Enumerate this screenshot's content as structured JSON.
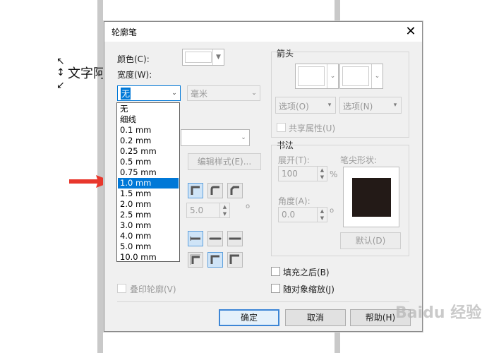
{
  "document": {
    "selected_text": "文字阿"
  },
  "dialog": {
    "title": "轮廓笔",
    "close_glyph": "✕",
    "color_label": "颜色(C):",
    "width_label": "宽度(W):",
    "width_value": "无",
    "unit_value": "毫米",
    "edit_style_label": "编辑样式(E)...",
    "miter_value": "5.0",
    "degree_glyph": "o",
    "overprint_label": "叠印轮廓(V)",
    "arrows": {
      "title": "箭头",
      "options_left": "选项(O)",
      "options_right": "选项(N)",
      "share_label": "共享属性(U)"
    },
    "calligraphy": {
      "title": "书法",
      "stretch_label": "展开(T):",
      "stretch_value": "100",
      "stretch_unit": "%",
      "angle_label": "角度(A):",
      "angle_value": "0.0",
      "nib_label": "笔尖形状:",
      "default_label": "默认(D)"
    },
    "behind_fill_label": "填充之后(B)",
    "scale_label": "随对象缩放(J)",
    "ok_label": "确定",
    "cancel_label": "取消",
    "help_label": "帮助(H)",
    "width_options": [
      "无",
      "细线",
      "0.1 mm",
      "0.2 mm",
      "0.25 mm",
      "0.5 mm",
      "0.75 mm",
      "1.0 mm",
      "1.5 mm",
      "2.0 mm",
      "2.5 mm",
      "3.0 mm",
      "4.0 mm",
      "5.0 mm",
      "10.0 mm"
    ],
    "selected_option": "1.0 mm"
  },
  "watermark": "Baidu 经验",
  "colors": {
    "accent": "#0078d7",
    "arrow": "#e8372c",
    "nib": "#231a17"
  }
}
